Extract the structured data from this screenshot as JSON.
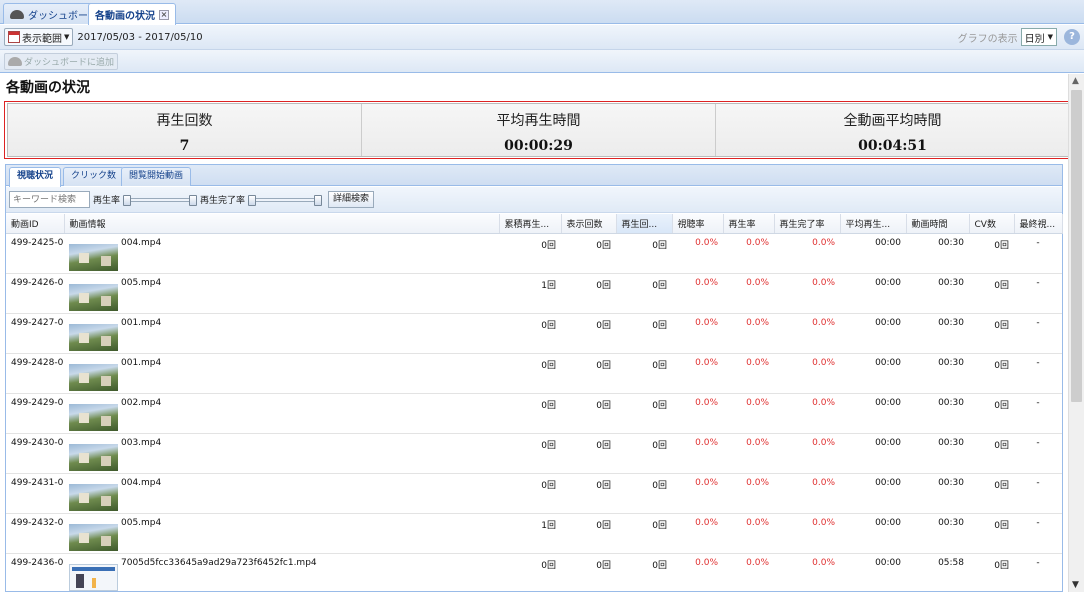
{
  "tabs": [
    {
      "label": "ダッシュボード",
      "icon": "dashboard-icon"
    },
    {
      "label": "各動画の状況",
      "icon": "close-icon"
    }
  ],
  "toolbar": {
    "range_button": "表示範囲",
    "date_range": "2017/05/03 - 2017/05/10",
    "graph_label": "グラフの表示",
    "graph_select": "日別",
    "add_dashboard": "ダッシュボードに追加",
    "help": "?"
  },
  "page": {
    "title": "各動画の状況"
  },
  "summary": [
    {
      "label": "再生回数",
      "value": "7"
    },
    {
      "label": "平均再生時間",
      "value": "00:00:29"
    },
    {
      "label": "全動画平均時間",
      "value": "00:04:51"
    }
  ],
  "inner_tabs": [
    "視聴状況",
    "クリック数",
    "閲覧開始動画"
  ],
  "filter": {
    "keyword_placeholder": "キーワード検索",
    "play_rate": "再生率",
    "completion_rate": "再生完了率",
    "detail_search": "詳細検索"
  },
  "columns": [
    "動画ID",
    "動画情報",
    "累積再生...",
    "表示回数",
    "再生回...",
    "視聴率",
    "再生率",
    "再生完了率",
    "平均再生...",
    "動画時間",
    "CV数",
    "最終視..."
  ],
  "rows": [
    {
      "id": "499-2425-0",
      "name": "004.mp4",
      "thumb": "photo",
      "cum": "0回",
      "views": "0回",
      "plays": "0回",
      "watch_rate": "0.0%",
      "play_rate": "0.0%",
      "complete_rate": "0.0%",
      "avg": "00:00",
      "duration": "00:30",
      "cv": "0回",
      "last": "-"
    },
    {
      "id": "499-2426-0",
      "name": "005.mp4",
      "thumb": "photo",
      "cum": "1回",
      "views": "0回",
      "plays": "0回",
      "watch_rate": "0.0%",
      "play_rate": "0.0%",
      "complete_rate": "0.0%",
      "avg": "00:00",
      "duration": "00:30",
      "cv": "0回",
      "last": "-"
    },
    {
      "id": "499-2427-0",
      "name": "001.mp4",
      "thumb": "photo",
      "cum": "0回",
      "views": "0回",
      "plays": "0回",
      "watch_rate": "0.0%",
      "play_rate": "0.0%",
      "complete_rate": "0.0%",
      "avg": "00:00",
      "duration": "00:30",
      "cv": "0回",
      "last": "-"
    },
    {
      "id": "499-2428-0",
      "name": "001.mp4",
      "thumb": "photo",
      "cum": "0回",
      "views": "0回",
      "plays": "0回",
      "watch_rate": "0.0%",
      "play_rate": "0.0%",
      "complete_rate": "0.0%",
      "avg": "00:00",
      "duration": "00:30",
      "cv": "0回",
      "last": "-"
    },
    {
      "id": "499-2429-0",
      "name": "002.mp4",
      "thumb": "photo",
      "cum": "0回",
      "views": "0回",
      "plays": "0回",
      "watch_rate": "0.0%",
      "play_rate": "0.0%",
      "complete_rate": "0.0%",
      "avg": "00:00",
      "duration": "00:30",
      "cv": "0回",
      "last": "-"
    },
    {
      "id": "499-2430-0",
      "name": "003.mp4",
      "thumb": "photo",
      "cum": "0回",
      "views": "0回",
      "plays": "0回",
      "watch_rate": "0.0%",
      "play_rate": "0.0%",
      "complete_rate": "0.0%",
      "avg": "00:00",
      "duration": "00:30",
      "cv": "0回",
      "last": "-"
    },
    {
      "id": "499-2431-0",
      "name": "004.mp4",
      "thumb": "photo",
      "cum": "0回",
      "views": "0回",
      "plays": "0回",
      "watch_rate": "0.0%",
      "play_rate": "0.0%",
      "complete_rate": "0.0%",
      "avg": "00:00",
      "duration": "00:30",
      "cv": "0回",
      "last": "-"
    },
    {
      "id": "499-2432-0",
      "name": "005.mp4",
      "thumb": "photo",
      "cum": "1回",
      "views": "0回",
      "plays": "0回",
      "watch_rate": "0.0%",
      "play_rate": "0.0%",
      "complete_rate": "0.0%",
      "avg": "00:00",
      "duration": "00:30",
      "cv": "0回",
      "last": "-"
    },
    {
      "id": "499-2436-0",
      "name": "7005d5fcc33645a9ad29a723f6452fc1.mp4",
      "thumb": "doc",
      "cum": "0回",
      "views": "0回",
      "plays": "0回",
      "watch_rate": "0.0%",
      "play_rate": "0.0%",
      "complete_rate": "0.0%",
      "avg": "00:00",
      "duration": "05:58",
      "cv": "0回",
      "last": "-"
    }
  ],
  "colors": {
    "accent": "#15428b",
    "border": "#99bbe8",
    "highlight": "#dd2222",
    "rate": "#e03030"
  }
}
